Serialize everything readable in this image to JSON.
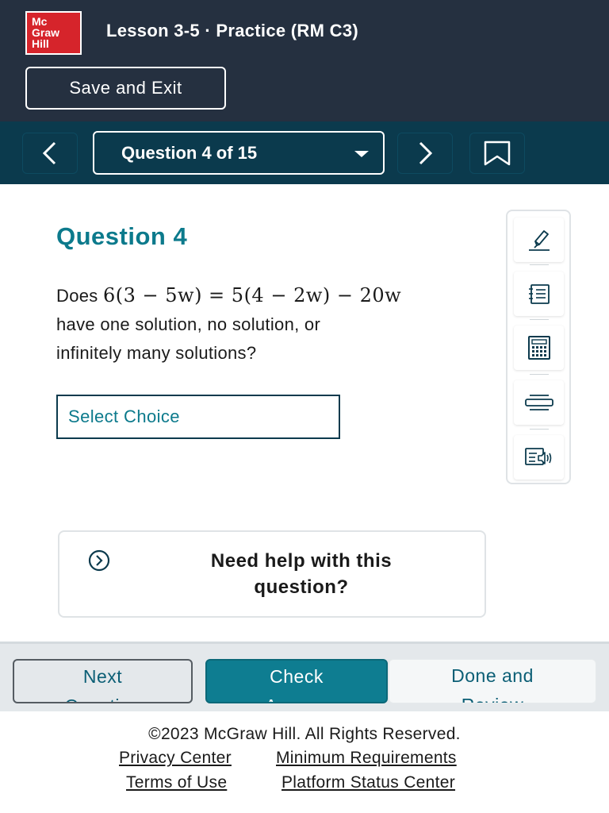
{
  "header": {
    "logo_lines": [
      "Mc",
      "Graw",
      "Hill"
    ],
    "lesson_title": "Lesson 3-5 · Practice (RM C3)",
    "save_exit_label": "Save and Exit"
  },
  "nav": {
    "question_selector": "Question 4 of 15",
    "prev_icon": "chevron-left-icon",
    "next_icon": "chevron-right-icon",
    "bookmark_icon": "bookmark-icon"
  },
  "question": {
    "heading": "Question 4",
    "prefix": "Does ",
    "equation": "6(3 − 5w) = 5(4 − 2w) − 20w",
    "line2": " have one solution, no solution, or",
    "line3": "infinitely many solutions?",
    "select_placeholder": "Select Choice"
  },
  "toolbar": {
    "tools": [
      "highlighter-icon",
      "notepad-icon",
      "calculator-icon",
      "line-reader-icon",
      "text-to-speech-icon"
    ]
  },
  "help": {
    "line1": "Need help with this",
    "line2": "question?",
    "icon": "chevron-circle-right-icon"
  },
  "bottom_bar": {
    "next_line1": "Next",
    "next_line2": "Question",
    "check_line1": "Check",
    "check_line2": "Answer",
    "done_line1": "Done and",
    "done_line2": "Review"
  },
  "footer": {
    "copyright": "©2023 McGraw Hill. All Rights Reserved.",
    "privacy": "Privacy Center",
    "requirements": "Minimum Requirements",
    "terms": "Terms of Use",
    "status": "Platform Status Center"
  },
  "colors": {
    "header_bg": "#253040",
    "navbar_bg": "#0b3a4d",
    "accent": "#0c7a8c",
    "logo_red": "#d6242b",
    "check_button": "#0e7d91"
  }
}
